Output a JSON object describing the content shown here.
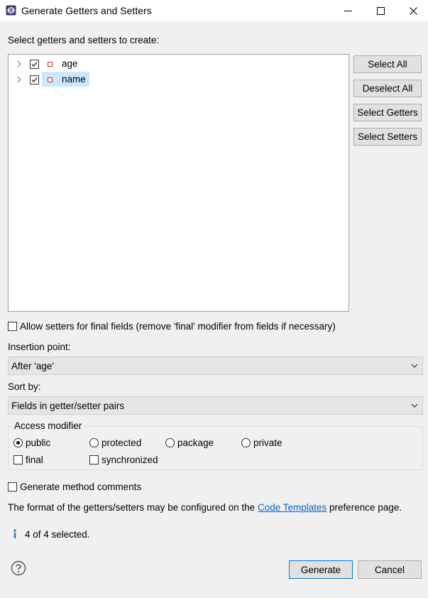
{
  "window": {
    "title": "Generate Getters and Setters",
    "minimize_glyph": "—",
    "maximize_glyph": "☐",
    "close_glyph": "✕"
  },
  "tree": {
    "label": "Select getters and setters to create:",
    "items": [
      {
        "name": "age",
        "checked": true,
        "selected": false
      },
      {
        "name": "name",
        "checked": true,
        "selected": true
      }
    ]
  },
  "side_buttons": {
    "select_all": "Select All",
    "deselect_all": "Deselect All",
    "select_getters": "Select Getters",
    "select_setters": "Select Setters"
  },
  "allow_setters_final": {
    "label": "Allow setters for final fields (remove 'final' modifier from fields if necessary)",
    "checked": false
  },
  "insertion_point": {
    "label": "Insertion point:",
    "value": "After 'age'"
  },
  "sort_by": {
    "label": "Sort by:",
    "value": "Fields in getter/setter pairs"
  },
  "access_modifier": {
    "title": "Access modifier",
    "options": [
      {
        "label": "public",
        "selected": true
      },
      {
        "label": "protected",
        "selected": false
      },
      {
        "label": "package",
        "selected": false
      },
      {
        "label": "private",
        "selected": false
      }
    ],
    "final": {
      "label": "final",
      "checked": false
    },
    "synchronized": {
      "label": "synchronized",
      "checked": false
    }
  },
  "generate_comments": {
    "label": "Generate method comments",
    "checked": false
  },
  "info_text": {
    "before": "The format of the getters/setters may be configured on the ",
    "link": "Code Templates",
    "after": " preference page."
  },
  "status": {
    "icon": "info-icon",
    "text": "4 of 4 selected."
  },
  "footer": {
    "help_icon": "help-icon",
    "generate": "Generate",
    "cancel": "Cancel"
  },
  "colors": {
    "accent": "#0078d7",
    "selection": "#cce8ff",
    "link": "#0066cc",
    "field_icon": "#d0302f"
  }
}
